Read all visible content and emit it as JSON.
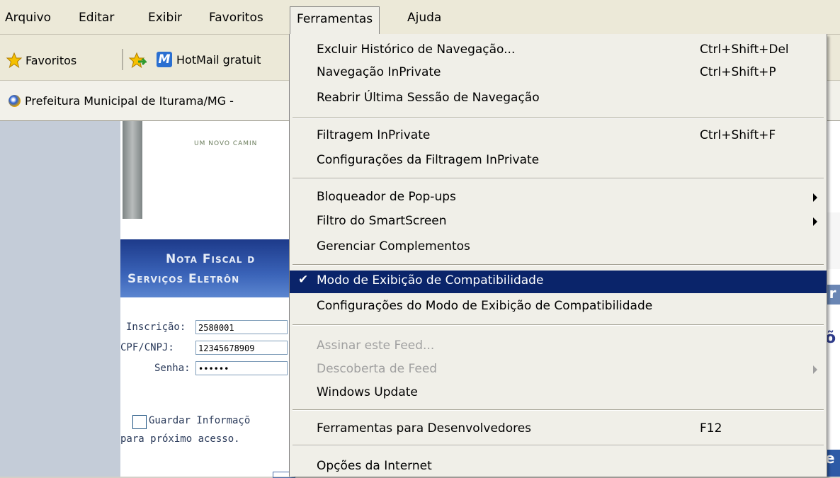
{
  "menubar": {
    "items": [
      "Arquivo",
      "Editar",
      "Exibir",
      "Favoritos",
      "Ferramentas",
      "Ajuda"
    ]
  },
  "favorites_bar": {
    "favorites_label": "Favoritos",
    "hotmail_label": "HotMail gratuit"
  },
  "tab": {
    "title": "Prefeitura Municipal de Iturama/MG -"
  },
  "page": {
    "slogan": "UM NOVO CAMIN",
    "heading_line1": "Nota Fiscal d",
    "heading_line2": "Serviços Eletrôn",
    "inscricao_label": "Inscrição:",
    "inscricao_value": "2580001",
    "cpf_label": "CPF/CNPJ:",
    "cpf_value": "12345678909",
    "senha_label": "Senha:",
    "senha_value": "••••••",
    "guardar_label": "Guardar Informaçõ",
    "proximo_label": "para próximo acesso.",
    "frag_a": "r",
    "frag_b": "õ",
    "frag_c": "e"
  },
  "tools_menu": {
    "items": [
      {
        "label": "Excluir Histórico de Navegação...",
        "shortcut": "Ctrl+Shift+Del"
      },
      {
        "label": "Navegação InPrivate",
        "shortcut": "Ctrl+Shift+P"
      },
      {
        "label": "Reabrir Última Sessão de Navegação"
      },
      {
        "label": "Filtragem InPrivate",
        "shortcut": "Ctrl+Shift+F"
      },
      {
        "label": "Configurações da Filtragem InPrivate"
      },
      {
        "label": "Bloqueador de Pop-ups"
      },
      {
        "label": "Filtro do SmartScreen"
      },
      {
        "label": "Gerenciar Complementos"
      },
      {
        "label": "Modo de Exibição de Compatibilidade",
        "checked": true,
        "check_mark": "✔"
      },
      {
        "label": "Configurações do Modo de Exibição de Compatibilidade"
      },
      {
        "label": "Assinar este Feed..."
      },
      {
        "label": "Descoberta de Feed"
      },
      {
        "label": "Windows Update"
      },
      {
        "label": "Ferramentas para Desenvolvedores",
        "shortcut": "F12"
      },
      {
        "label": "Opções da Internet"
      }
    ]
  }
}
